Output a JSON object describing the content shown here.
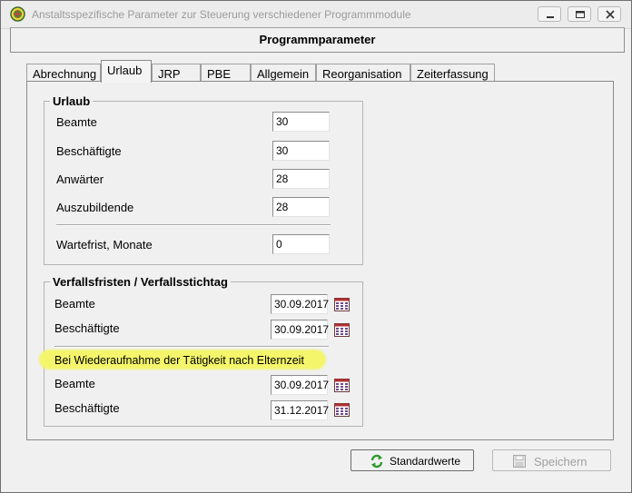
{
  "window": {
    "title": "Anstaltsspezifische Parameter zur Steuerung verschiedener Programmmodule"
  },
  "header": {
    "title": "Programmparameter"
  },
  "tabs": [
    {
      "label": "Abrechnung",
      "active": false
    },
    {
      "label": "Urlaub",
      "active": true
    },
    {
      "label": "JRP",
      "active": false
    },
    {
      "label": "PBE",
      "active": false
    },
    {
      "label": "Allgemein",
      "active": false
    },
    {
      "label": "Reorganisation",
      "active": false
    },
    {
      "label": "Zeiterfassung",
      "active": false
    }
  ],
  "urlaub": {
    "title": "Urlaub",
    "rows": [
      {
        "label": "Beamte",
        "value": "30"
      },
      {
        "label": "Beschäftigte",
        "value": "30"
      },
      {
        "label": "Anwärter",
        "value": "28"
      },
      {
        "label": "Auszubildende",
        "value": "28"
      }
    ],
    "wartefrist": {
      "label": "Wartefrist, Monate",
      "value": "0"
    }
  },
  "verfall": {
    "title": "Verfallsfristen / Verfallsstichtag",
    "rows": [
      {
        "label": "Beamte",
        "value": "30.09.2017"
      },
      {
        "label": "Beschäftigte",
        "value": "30.09.2017"
      }
    ],
    "elternzeit_label": "Bei Wiederaufnahme der Tätigkeit nach Elternzeit",
    "elternzeit_rows": [
      {
        "label": "Beamte",
        "value": "30.09.2017"
      },
      {
        "label": "Beschäftigte",
        "value": "31.12.2017"
      }
    ]
  },
  "buttons": {
    "standardwerte": "Standardwerte",
    "speichern": "Speichern"
  },
  "colors": {
    "highlight": "#f4f56a",
    "refresh_icon": "#2e9a2e"
  }
}
